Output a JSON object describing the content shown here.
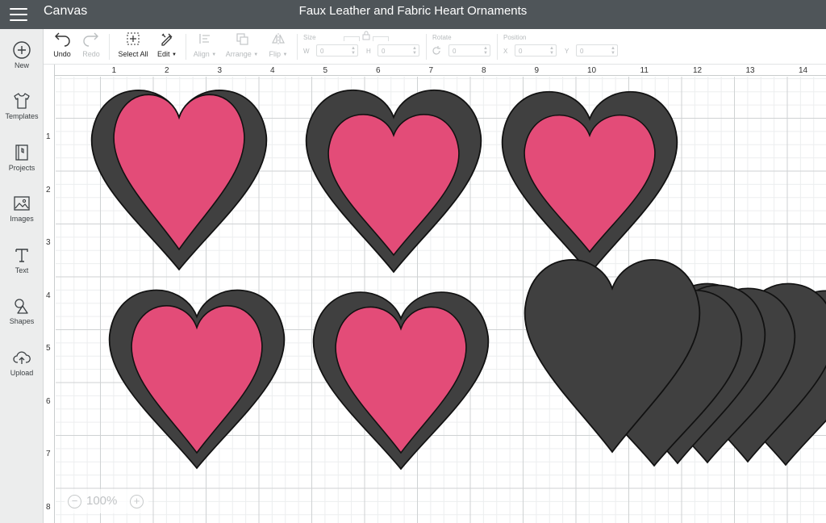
{
  "header": {
    "app_title": "Canvas",
    "project_title": "Faux Leather and Fabric Heart Ornaments"
  },
  "sidebar": {
    "items": [
      {
        "label": "New",
        "icon": "plus-circle-icon"
      },
      {
        "label": "Templates",
        "icon": "tshirt-icon"
      },
      {
        "label": "Projects",
        "icon": "projects-icon"
      },
      {
        "label": "Images",
        "icon": "image-icon"
      },
      {
        "label": "Text",
        "icon": "text-icon"
      },
      {
        "label": "Shapes",
        "icon": "shapes-icon"
      },
      {
        "label": "Upload",
        "icon": "cloud-upload-icon"
      }
    ]
  },
  "toolbar": {
    "undo": "Undo",
    "redo": "Redo",
    "select_all": "Select All",
    "edit": "Edit",
    "align": "Align",
    "arrange": "Arrange",
    "flip": "Flip",
    "size_label": "Size",
    "w_label": "W",
    "h_label": "H",
    "w_value": "0",
    "h_value": "0",
    "rotate_label": "Rotate",
    "rotate_value": "0",
    "position_label": "Position",
    "x_label": "X",
    "y_label": "Y",
    "x_value": "0",
    "y_value": "0"
  },
  "rulers": {
    "top": [
      "1",
      "2",
      "3",
      "4",
      "5",
      "6",
      "7",
      "8",
      "9",
      "10",
      "11",
      "12",
      "13",
      "14"
    ],
    "left": [
      "1",
      "2",
      "3",
      "4",
      "5",
      "6",
      "7",
      "8"
    ]
  },
  "zoom": {
    "level": "100%",
    "minus": "−",
    "plus": "+"
  },
  "colors": {
    "header_bg": "#4f5559",
    "leather": "#404040",
    "fabric": "#e34c78"
  }
}
